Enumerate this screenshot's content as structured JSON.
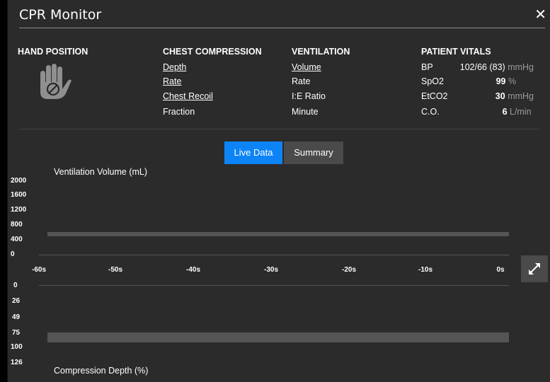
{
  "window": {
    "title": "CPR Monitor",
    "close_label": "✕"
  },
  "hand_position": {
    "header": "HAND POSITION",
    "icon": "hand-stop-icon"
  },
  "chest_compression": {
    "header": "CHEST COMPRESSION",
    "depth": "Depth",
    "rate": "Rate",
    "recoil": "Chest Recoil",
    "fraction": "Fraction"
  },
  "ventilation": {
    "header": "VENTILATION",
    "volume": "Volume",
    "rate": "Rate",
    "ie_ratio": "I:E Ratio",
    "minute": "Minute"
  },
  "vitals": {
    "header": "PATIENT VITALS",
    "items": [
      {
        "label": "BP",
        "value": "102/66 (83)",
        "unit": "mmHg"
      },
      {
        "label": "SpO2",
        "value": "99",
        "unit": "%"
      },
      {
        "label": "EtCO2",
        "value": "30",
        "unit": "mmHg"
      },
      {
        "label": "C.O.",
        "value": "6",
        "unit": "L/min"
      }
    ]
  },
  "tabs": {
    "live": "Live Data",
    "summary": "Summary"
  },
  "ventilation_chart": {
    "title": "Ventilation Volume (mL)",
    "yticks": [
      "2000",
      "1600",
      "1200",
      "800",
      "400",
      "0"
    ],
    "level": 560
  },
  "time_axis": {
    "ticks": [
      "-60s",
      "-50s",
      "-40s",
      "-30s",
      "-20s",
      "-10s",
      "0s"
    ]
  },
  "compression_chart": {
    "title": "Compression Depth (%)",
    "yticks": [
      "0",
      "26",
      "49",
      "75",
      "100",
      "126"
    ],
    "band_from": 78,
    "band_to": 94
  },
  "colors": {
    "accent": "#0d84f5",
    "background": "#2b2b2b",
    "data": "#555555"
  }
}
